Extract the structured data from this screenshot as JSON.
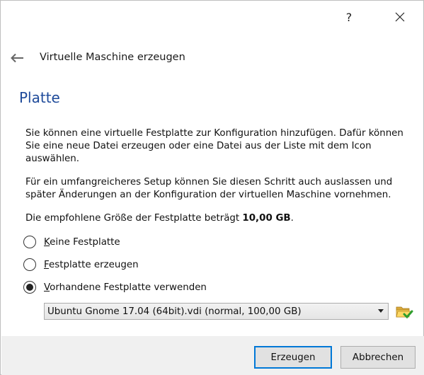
{
  "window": {
    "help_label": "?",
    "close_icon": "close-icon"
  },
  "header": {
    "back_icon": "back-arrow-icon",
    "title": "Virtuelle Maschine erzeugen"
  },
  "page": {
    "heading": "Platte",
    "paragraph1": "Sie können eine virtuelle Festplatte zur Konfiguration hinzufügen. Dafür können Sie eine neue Datei erzeugen oder eine Datei aus der Liste mit dem Icon auswählen.",
    "paragraph2": "Für ein umfangreicheres Setup können Sie diesen Schritt auch auslassen und später Änderungen an der Konfiguration der virtuellen Maschine vornehmen.",
    "recommended_prefix": "Die empfohlene Größe der Festplatte beträgt ",
    "recommended_size": "10,00 GB",
    "recommended_suffix": "."
  },
  "options": [
    {
      "mnemonic": "K",
      "rest": "eine Festplatte",
      "selected": false
    },
    {
      "mnemonic": "F",
      "rest": "estplatte erzeugen",
      "selected": false
    },
    {
      "mnemonic": "V",
      "rest": "orhandene Festplatte verwenden",
      "selected": true
    }
  ],
  "disk_select": {
    "value": "Ubuntu Gnome 17.04 (64bit).vdi (normal, 100,00 GB)",
    "folder_icon": "folder-open-icon"
  },
  "footer": {
    "create_label": "Erzeugen",
    "cancel_label": "Abbrechen"
  },
  "colors": {
    "heading": "#1e4a9a",
    "default_button_border": "#0078d7",
    "footer_bg": "#f0f0f0"
  }
}
